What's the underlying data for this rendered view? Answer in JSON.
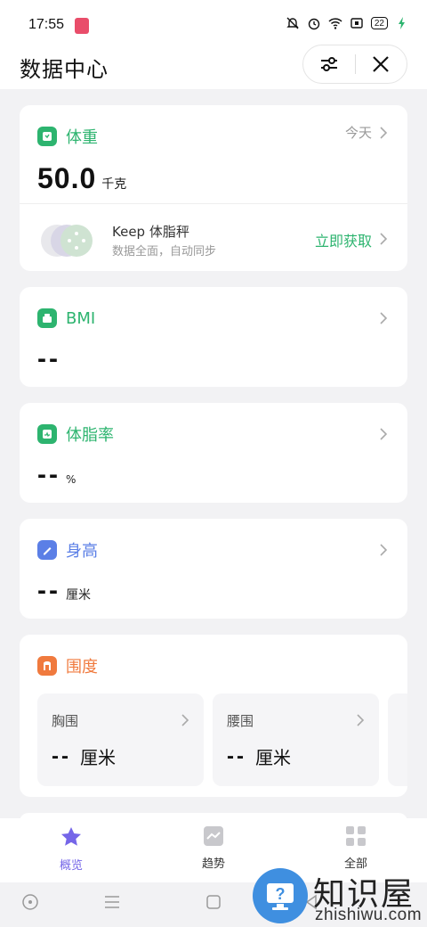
{
  "status_bar": {
    "time": "17:55",
    "battery": "22",
    "icons": [
      "bell-off-icon",
      "alarm-icon",
      "wifi-icon",
      "sim-icon",
      "battery-icon",
      "charging-icon"
    ]
  },
  "header": {
    "title": "数据中心",
    "filter_icon": "sliders-icon",
    "close_icon": "close-icon"
  },
  "weight_card": {
    "title": "体重",
    "date_label": "今天",
    "value": "50.0",
    "unit": "千克",
    "promo": {
      "title": "Keep 体脂秤",
      "subtitle": "数据全面，自动同步",
      "action": "立即获取"
    }
  },
  "bmi_card": {
    "title": "BMI",
    "value": "--"
  },
  "body_fat_card": {
    "title": "体脂率",
    "value": "--",
    "unit": "%"
  },
  "height_card": {
    "title": "身高",
    "value": "--",
    "unit": "厘米"
  },
  "girth_card": {
    "title": "围度",
    "items": [
      {
        "label": "胸围",
        "value": "--",
        "unit": "厘米"
      },
      {
        "label": "腰围",
        "value": "--",
        "unit": "厘米"
      },
      {
        "label": "",
        "value": "",
        "unit": ""
      }
    ]
  },
  "tabs": [
    {
      "label": "概览",
      "active": true
    },
    {
      "label": "趋势",
      "active": false
    },
    {
      "label": "全部",
      "active": false
    }
  ],
  "watermark": {
    "brand": "知识屋",
    "domain": "zhishiwu.com"
  },
  "colors": {
    "green": "#2db46f",
    "blue": "#5b7fe6",
    "orange": "#f07a3e",
    "purple": "#7566e8"
  }
}
